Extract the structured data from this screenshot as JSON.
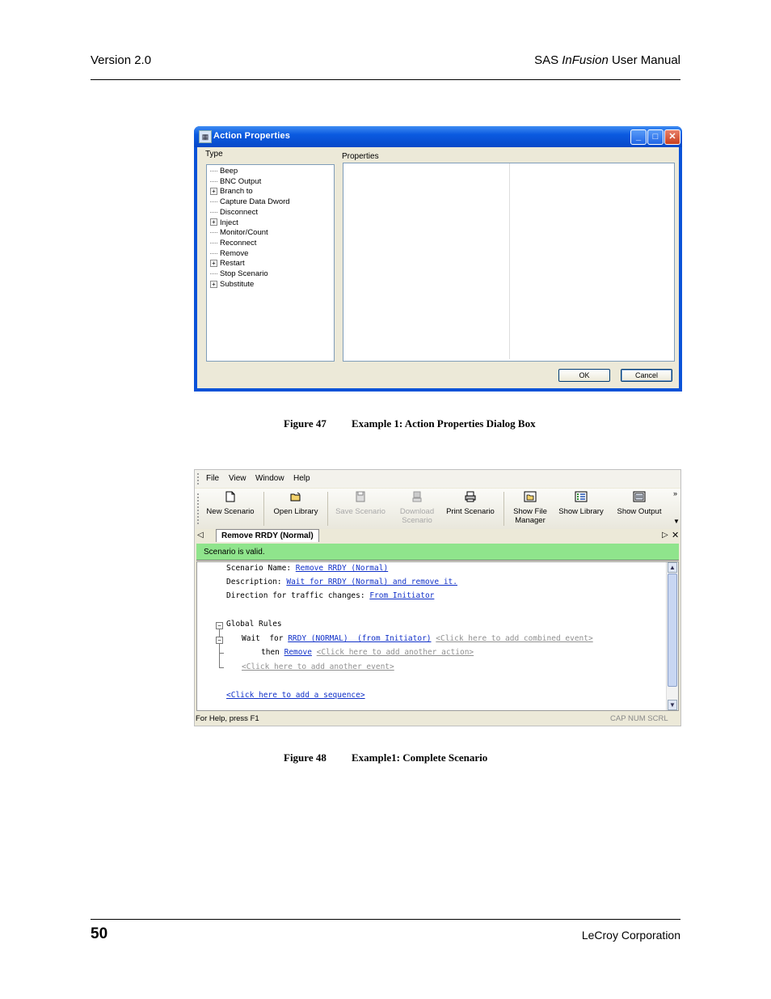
{
  "page": {
    "header_left": "Version 2.0",
    "header_right_prefix": "SAS ",
    "header_right_italic": "InFusion",
    "header_right_suffix": " User Manual",
    "page_number": "50",
    "footer_right": "LeCroy Corporation"
  },
  "figure47": {
    "label": "Figure 47",
    "caption": "Example 1:  Action Properties Dialog Box",
    "dialog": {
      "title": "Action Properties",
      "type_label": "Type",
      "properties_label": "Properties",
      "type_items": [
        {
          "label": "Beep",
          "expandable": false
        },
        {
          "label": "BNC Output",
          "expandable": false
        },
        {
          "label": "Branch to",
          "expandable": true
        },
        {
          "label": "Capture Data Dword",
          "expandable": false
        },
        {
          "label": "Disconnect",
          "expandable": false
        },
        {
          "label": "Inject",
          "expandable": true
        },
        {
          "label": "Monitor/Count",
          "expandable": false
        },
        {
          "label": "Reconnect",
          "expandable": false
        },
        {
          "label": "Remove",
          "expandable": false
        },
        {
          "label": "Restart",
          "expandable": true
        },
        {
          "label": "Stop Scenario",
          "expandable": false
        },
        {
          "label": "Substitute",
          "expandable": true
        }
      ],
      "ok_label": "OK",
      "cancel_label": "Cancel"
    }
  },
  "figure48": {
    "label": "Figure 48",
    "caption": "Example1: Complete Scenario",
    "menu": [
      "File",
      "View",
      "Window",
      "Help"
    ],
    "toolbar": [
      {
        "label": "New Scenario",
        "label2": "",
        "icon": "new-document-icon",
        "disabled": false
      },
      {
        "label": "Open Library",
        "label2": "",
        "icon": "open-folder-icon",
        "disabled": false
      },
      {
        "label": "Save Scenario",
        "label2": "",
        "icon": "save-disk-icon",
        "disabled": true
      },
      {
        "label": "Download",
        "label2": "Scenario",
        "icon": "download-icon",
        "disabled": true
      },
      {
        "label": "Print Scenario",
        "label2": "",
        "icon": "printer-icon",
        "disabled": false
      },
      {
        "label": "Show File",
        "label2": "Manager",
        "icon": "file-manager-icon",
        "disabled": false
      },
      {
        "label": "Show Library",
        "label2": "",
        "icon": "library-icon",
        "disabled": false
      },
      {
        "label": "Show Output",
        "label2": "",
        "icon": "output-window-icon",
        "disabled": false
      }
    ],
    "tab_label": "Remove RRDY (Normal)",
    "status_valid": "Scenario is valid.",
    "editor": {
      "scenario_name_label": "Scenario Name: ",
      "scenario_name_value": "Remove RRDY (Normal)",
      "description_label": "Description: ",
      "description_value": "Wait for RRDY (Normal) and remove it.",
      "direction_label": "Direction for traffic changes: ",
      "direction_value": "From Initiator",
      "global_rules": "Global Rules",
      "wait_for": "Wait  for ",
      "event_value": "RRDY (NORMAL)  (from Initiator)",
      "add_combined": "<Click here to add combined event>",
      "then": "then ",
      "action_value": "Remove",
      "add_action": "<Click here to add another action>",
      "add_event": "<Click here to add another event>",
      "add_sequence": "<Click here to add a sequence>"
    },
    "statusbar_left": "For Help, press F1",
    "statusbar_right": "CAP  NUM  SCRL"
  }
}
